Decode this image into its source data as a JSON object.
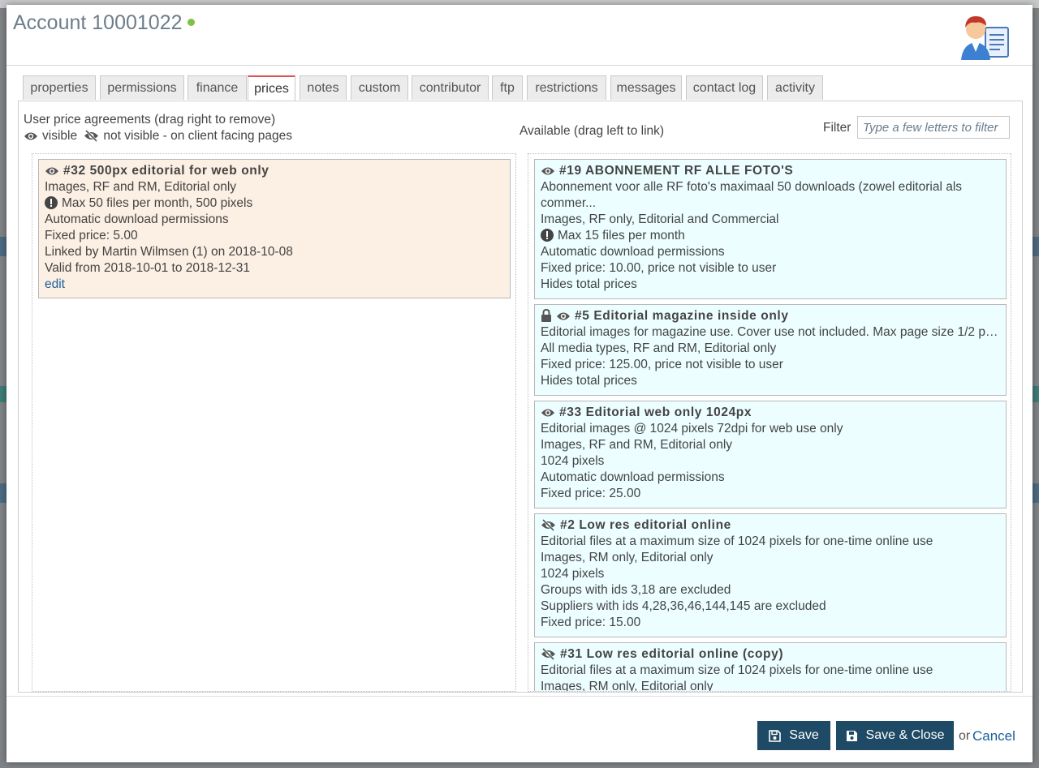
{
  "window": {
    "title": "Account 10001022",
    "status_color": "#7fc243"
  },
  "tabs": [
    {
      "label": "properties"
    },
    {
      "label": "permissions"
    },
    {
      "label": "finance"
    },
    {
      "label": "prices"
    },
    {
      "label": "notes"
    },
    {
      "label": "custom"
    },
    {
      "label": "contributor"
    },
    {
      "label": "ftp"
    },
    {
      "label": "restrictions"
    },
    {
      "label": "messages"
    },
    {
      "label": "contact log"
    },
    {
      "label": "activity"
    }
  ],
  "active_tab": "prices",
  "left": {
    "heading": "User price agreements (drag right to remove)",
    "legend_visible": "visible",
    "legend_not_visible": "not visible - on client facing pages",
    "cards": [
      {
        "icon": "eye-icon",
        "title": "#32 500px editorial for web only",
        "lines": [
          "Images, RF and RM, Editorial only"
        ],
        "warning": "Max 50 files per month, 500 pixels",
        "more": [
          "Automatic download permissions",
          "Fixed price: 5.00",
          "Linked by Martin Wilmsen (1) on 2018-10-08",
          "Valid from 2018-10-01 to 2018-12-31"
        ],
        "edit": "edit"
      }
    ]
  },
  "right": {
    "heading": "Available (drag left to link)",
    "filter_label": "Filter",
    "filter_placeholder": "Type a few letters to filter",
    "cards": [
      {
        "icons": [
          "eye-icon"
        ],
        "title": "#19 ABONNEMENT RF ALLE FOTO'S",
        "line1": "Abonnement voor alle RF foto's maximaal 50 downloads (zowel editorial als",
        "line2": "commer...",
        "line3": "Images, RF only, Editorial and Commercial",
        "warning": "Max 15 files per month",
        "line5": "Automatic download permissions",
        "line6": "Fixed price: 10.00, price not visible to user",
        "line7": "Hides total prices"
      },
      {
        "icons": [
          "lock-icon",
          "eye-icon"
        ],
        "title": "#5 Editorial magazine inside only",
        "line1": "Editorial images for magazine use. Cover use not included. Max page size 1/2 pa...",
        "line2": "All media types, RF and RM, Editorial only",
        "line3": "Fixed price: 125.00, price not visible to user",
        "line4": "Hides total prices"
      },
      {
        "icons": [
          "eye-icon"
        ],
        "title": "#33 Editorial web only 1024px",
        "line1": "Editorial images @ 1024 pixels 72dpi for web use only",
        "line2": "Images, RF and RM, Editorial only",
        "line3": "1024 pixels",
        "line4": "Automatic download permissions",
        "line5": "Fixed price: 25.00"
      },
      {
        "icons": [
          "eye-slash-icon"
        ],
        "title": "#2 Low res editorial online",
        "line1": "Editorial files at a maximum size of 1024 pixels for one-time online use",
        "line2": "Images, RM only, Editorial only",
        "line3": "1024 pixels",
        "line4": "Groups with ids 3,18 are excluded",
        "line5": "Suppliers with ids 4,28,36,46,144,145 are excluded",
        "line6": "Fixed price: 15.00"
      },
      {
        "icons": [
          "eye-slash-icon"
        ],
        "title": "#31 Low res editorial online (copy)",
        "line1": "Editorial files at a maximum size of 1024 pixels for one-time online use",
        "line2": "Images, RM only, Editorial only"
      }
    ]
  },
  "footer": {
    "save": "Save",
    "save_close": "Save & Close",
    "or": "or",
    "cancel": "Cancel",
    "button_color": "#1e4a66"
  }
}
